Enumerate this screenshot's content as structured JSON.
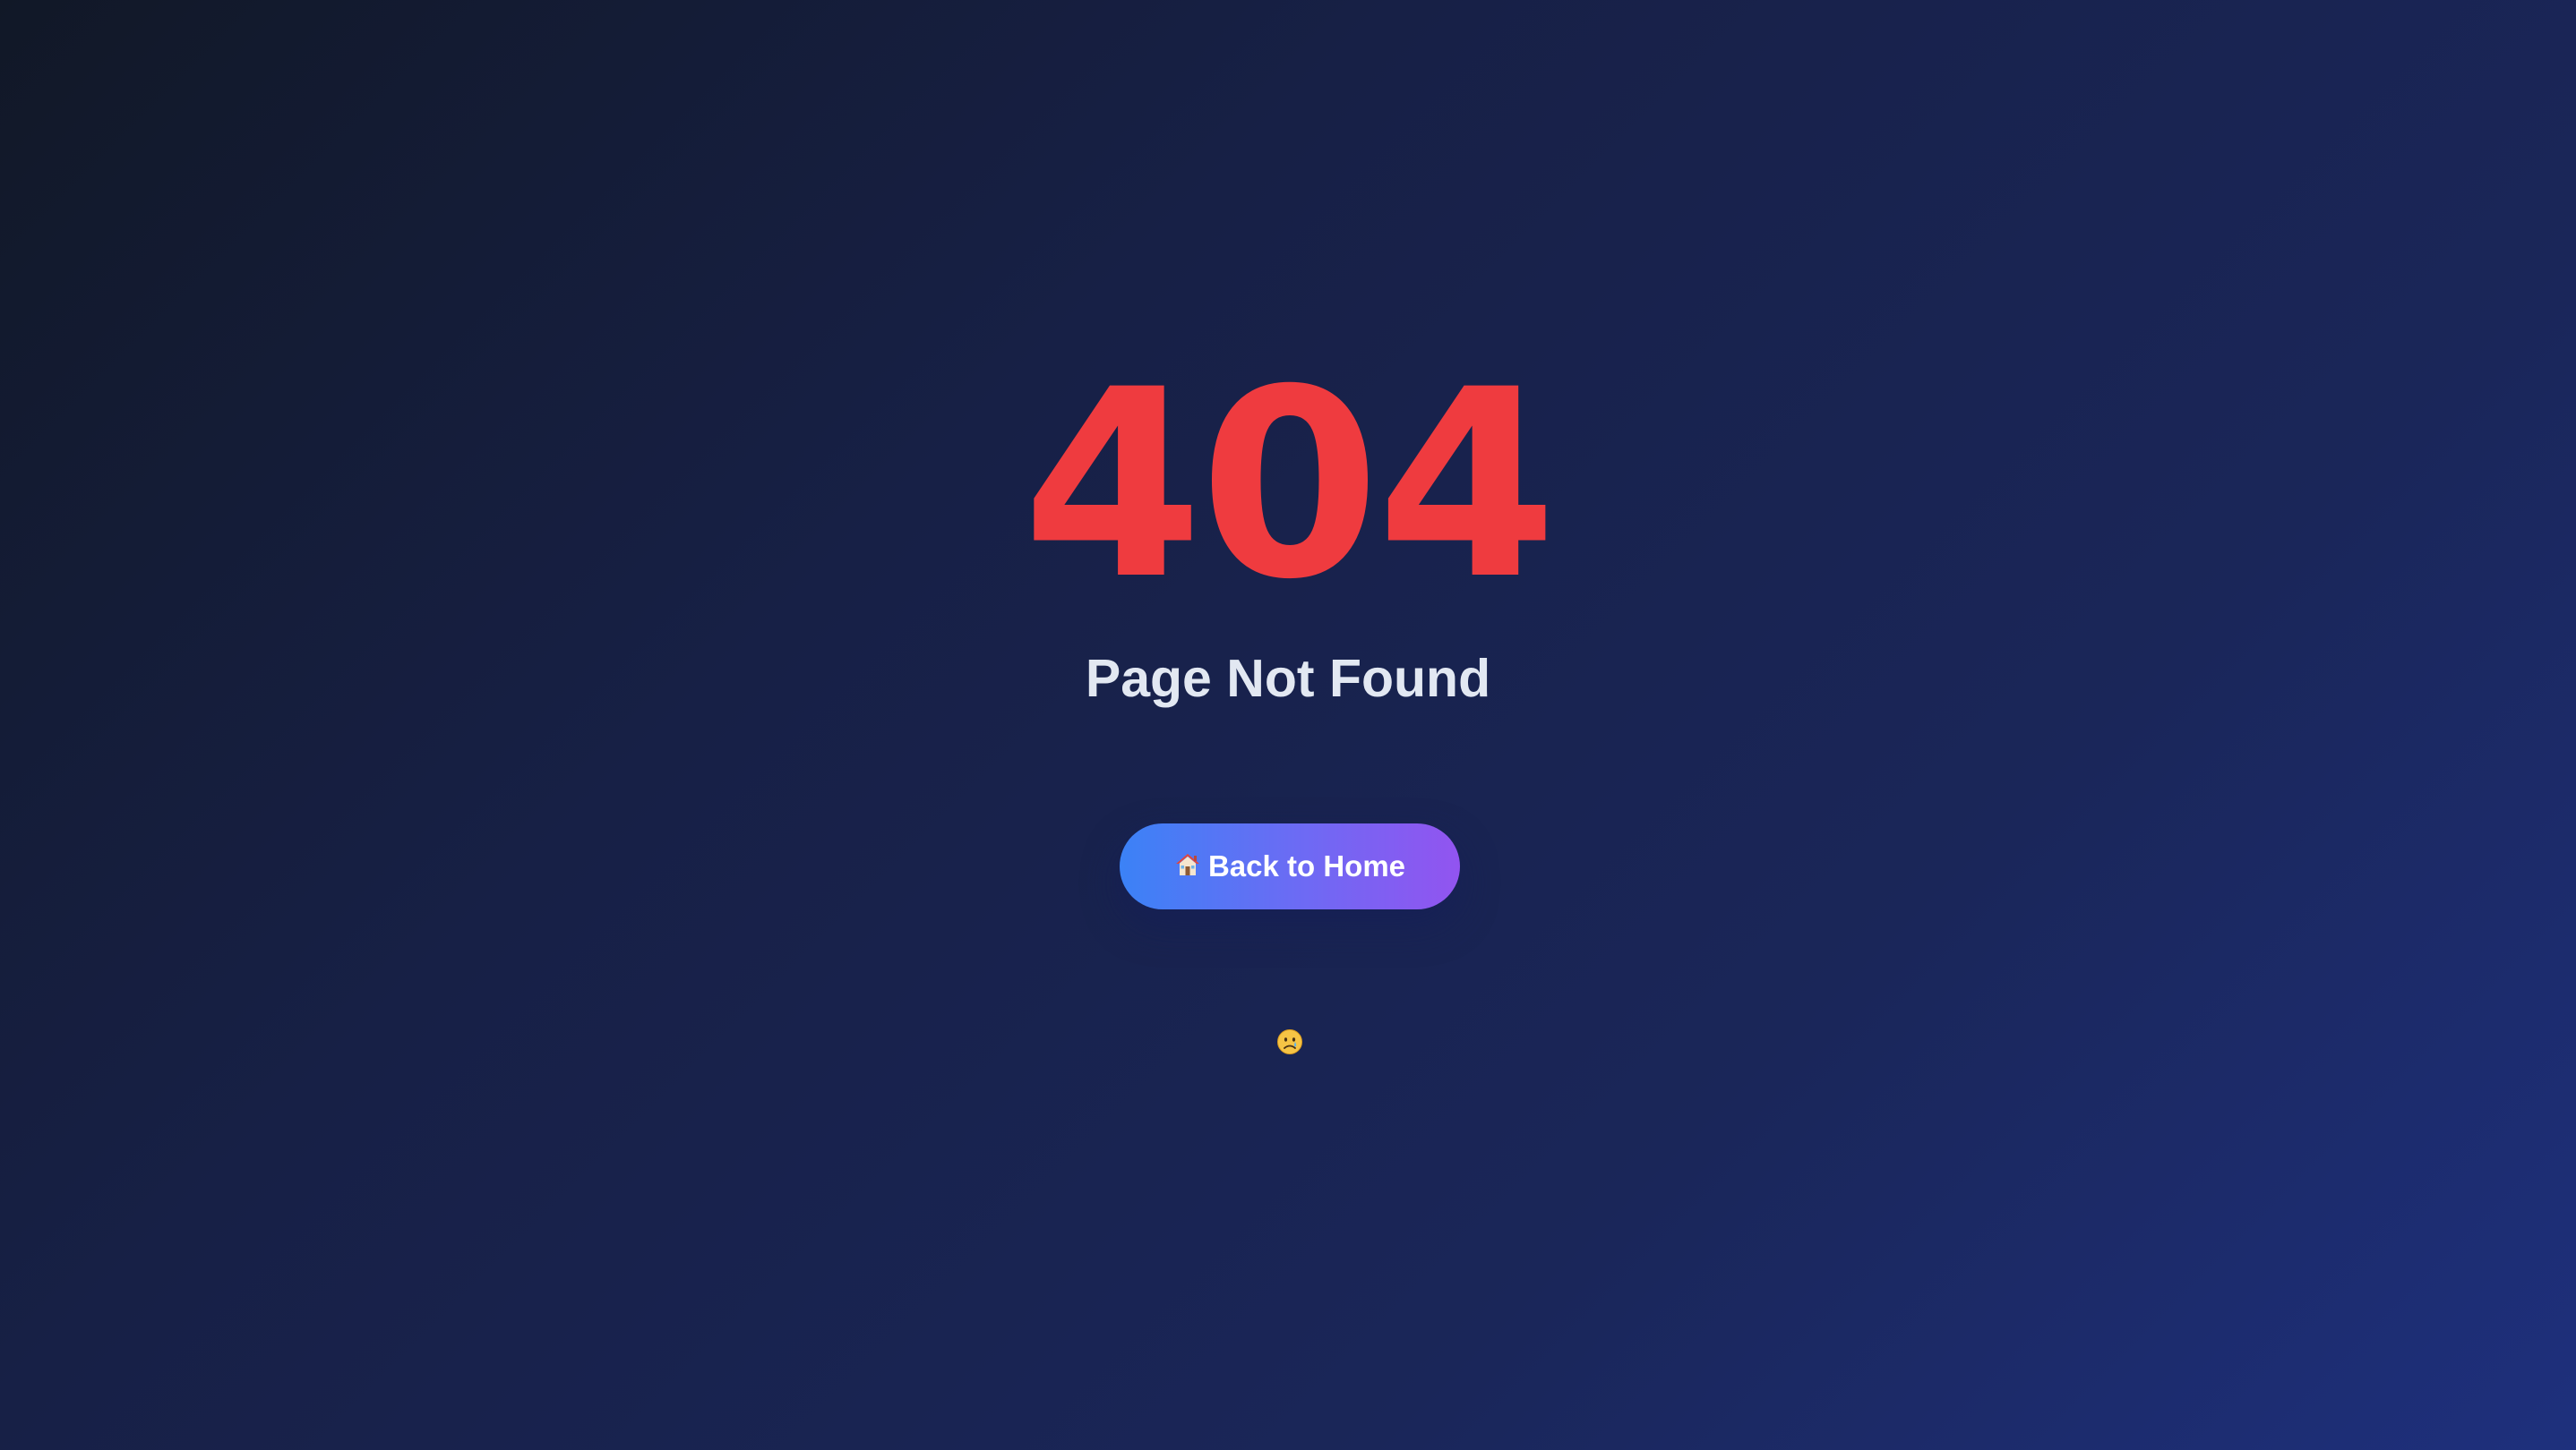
{
  "error": {
    "code": "404",
    "title": "Page Not Found"
  },
  "actions": {
    "home_button_label": "Back to Home",
    "home_icon": "house-icon"
  },
  "decoration": {
    "face_icon": "sad-face-icon"
  },
  "colors": {
    "error_code": "#ef3b3f",
    "title": "#e2e8f2",
    "button_start": "#3b82f6",
    "button_end": "#9254f0",
    "background_start": "#111827",
    "background_end": "#1e307d"
  }
}
